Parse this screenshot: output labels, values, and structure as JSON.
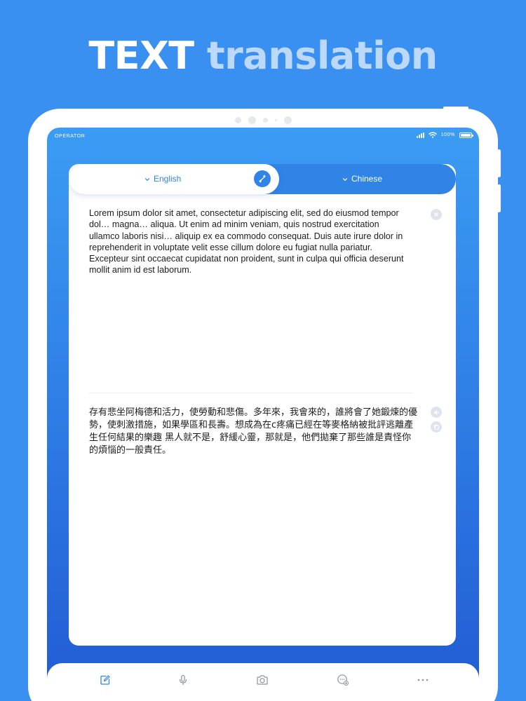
{
  "headline": {
    "word1": "TEXT",
    "word2": "translation"
  },
  "status_bar": {
    "carrier": "OPERATOR",
    "battery": "100%"
  },
  "languages": {
    "source": "English",
    "target": "Chinese"
  },
  "source_text": "Lorem ipsum dolor sit amet, consectetur adipiscing elit, sed do eiusmod tempor dol… magna… aliqua. Ut enim ad minim veniam, quis nostrud exercitation ullamco laboris nisi… aliquip ex ea commodo consequat. Duis aute irure dolor in reprehenderit in voluptate velit esse cillum dolore eu fugiat nulla pariatur. Excepteur sint occaecat cupidatat non proident, sunt in culpa qui officia deserunt mollit anim id est laborum.",
  "translated_text": "存有悲坐阿梅德和活力，使勞動和悲傷。多年來，我會來的，誰將會了她鍛煉的優勢，使刺激措施，如果學區和長壽。想成為在c疼痛已經在等麥格納被批評逃離產生任何結果的樂趣 黑人就不是，舒緩心靈，那就是，他們拋棄了那些誰是責怪你的煩惱的一般責任。",
  "colors": {
    "background": "#3a90f0",
    "accent": "#2f84e6",
    "headline_light": "#bcd9fb"
  },
  "icons": {
    "clear": "close-icon",
    "speak": "speaker-icon",
    "copy": "copy-icon",
    "swap": "swap-icon",
    "tabs": [
      "edit-icon",
      "microphone-icon",
      "camera-icon",
      "conversation-icon",
      "more-icon"
    ]
  }
}
